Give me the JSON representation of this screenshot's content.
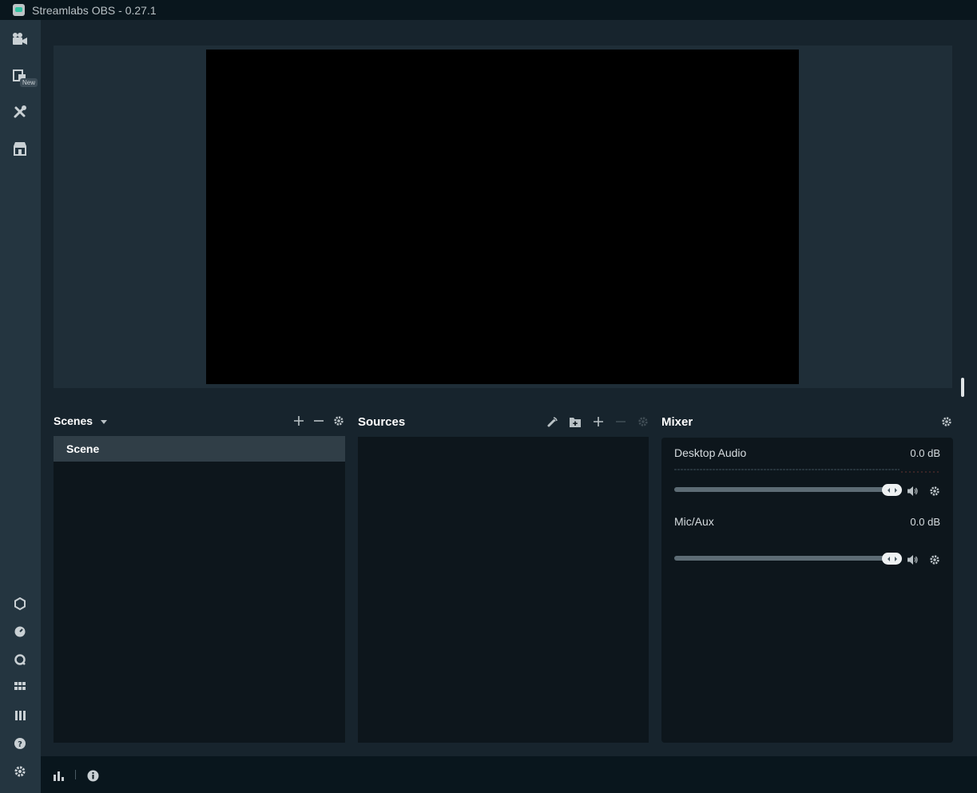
{
  "window": {
    "title": "Streamlabs OBS - 0.27.1"
  },
  "sidenav": {
    "top_items": [
      {
        "icon": "studio-camera-icon",
        "label": "Editor"
      },
      {
        "icon": "layout-icon",
        "label": "Layout Editor",
        "badge": "New"
      },
      {
        "icon": "themes-tools-icon",
        "label": "Themes"
      },
      {
        "icon": "store-icon",
        "label": "Store"
      }
    ],
    "bottom_items": [
      {
        "icon": "prime-icon"
      },
      {
        "icon": "dashboard-icon"
      },
      {
        "icon": "chat-icon"
      },
      {
        "icon": "grid-icon"
      },
      {
        "icon": "library-icon"
      },
      {
        "icon": "help-icon"
      },
      {
        "icon": "settings-icon"
      }
    ]
  },
  "scenes": {
    "title": "Scenes",
    "items": [
      "Scene"
    ],
    "active": "Scene"
  },
  "sources": {
    "title": "Sources",
    "items": []
  },
  "mixer": {
    "title": "Mixer",
    "channels": [
      {
        "name": "Desktop Audio",
        "db": "0.0 dB",
        "volume_fraction": 1.0
      },
      {
        "name": "Mic/Aux",
        "db": "0.0 dB",
        "volume_fraction": 1.0
      }
    ]
  },
  "footer": {
    "icons": [
      "performance-chart-icon",
      "info-icon"
    ]
  },
  "colors": {
    "background": "#17242d",
    "titlebar": "#09161d",
    "sidenav": "#243540",
    "panel": "#0d161c",
    "active_row": "#303e47",
    "accent": "#31c3a2"
  }
}
